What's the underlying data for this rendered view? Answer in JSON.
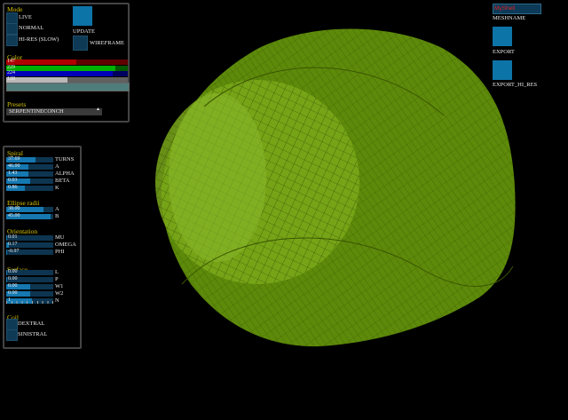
{
  "mode": {
    "title": "Mode",
    "options": [
      "LIVE",
      "NORMAL",
      "HI-RES (SLOW)"
    ],
    "update_label": "UPDATE",
    "wireframe_label": "WIREFRAME"
  },
  "color": {
    "title": "Color",
    "channels": [
      {
        "value": "147",
        "fraction": 0.576,
        "fill": "#b00000",
        "bg": "#600000"
      },
      {
        "value": "229",
        "fraction": 0.898,
        "fill": "#00b000",
        "bg": "#005a00"
      },
      {
        "value": "224",
        "fraction": 0.878,
        "fill": "#0000b8",
        "bg": "#000060"
      },
      {
        "value": "128",
        "fraction": 0.502,
        "fill": "#b8b8b8",
        "bg": "#606060"
      }
    ],
    "swatch": "#4e7d7b"
  },
  "presets": {
    "title": "Presets",
    "selected": "SERPENTINECONCH"
  },
  "spiral": {
    "title": "Spiral",
    "params": [
      {
        "value": "37.69",
        "name": "TURNS",
        "fraction": 0.62
      },
      {
        "value": "46.00",
        "name": "A",
        "fraction": 0.47
      },
      {
        "value": "1.43",
        "name": "ALPHA",
        "fraction": 0.47
      },
      {
        "value": "0.03",
        "name": "BETA",
        "fraction": 0.5
      },
      {
        "value": "0.86",
        "name": "K",
        "fraction": 0.4
      }
    ]
  },
  "ellipse": {
    "title": "Ellipse radii",
    "params": [
      {
        "value": "38.00",
        "name": "A",
        "fraction": 0.8
      },
      {
        "value": "45.00",
        "name": "B",
        "fraction": 0.95
      }
    ]
  },
  "orientation": {
    "title": "Orientation",
    "params": [
      {
        "value": "0.01",
        "name": "MU",
        "fraction": 0.02
      },
      {
        "value": "0.17",
        "name": "OMEGA",
        "fraction": 0.05
      },
      {
        "value": "-0.97",
        "name": "PHI",
        "fraction": 0.02
      }
    ]
  },
  "surface": {
    "title": "Surface",
    "params": [
      {
        "value": "0.00",
        "name": "L",
        "fraction": 0.02
      },
      {
        "value": "0.00",
        "name": "P",
        "fraction": 0.02
      },
      {
        "value": "0.00",
        "name": "W1",
        "fraction": 0.5
      },
      {
        "value": "0.00",
        "name": "W2",
        "fraction": 0.5
      },
      {
        "value": "1",
        "name": "N",
        "fraction": 0.55
      }
    ]
  },
  "coil": {
    "title": "Coil",
    "options": [
      "DEXTRAL",
      "SINISTRAL"
    ]
  },
  "export": {
    "mesh_name": "MyShell",
    "mesh_name_label": "MESHNAME",
    "export_label": "EXPORT",
    "export_hi_label": "EXPORT_HI_RES"
  },
  "shell_color": "#6f9c10"
}
